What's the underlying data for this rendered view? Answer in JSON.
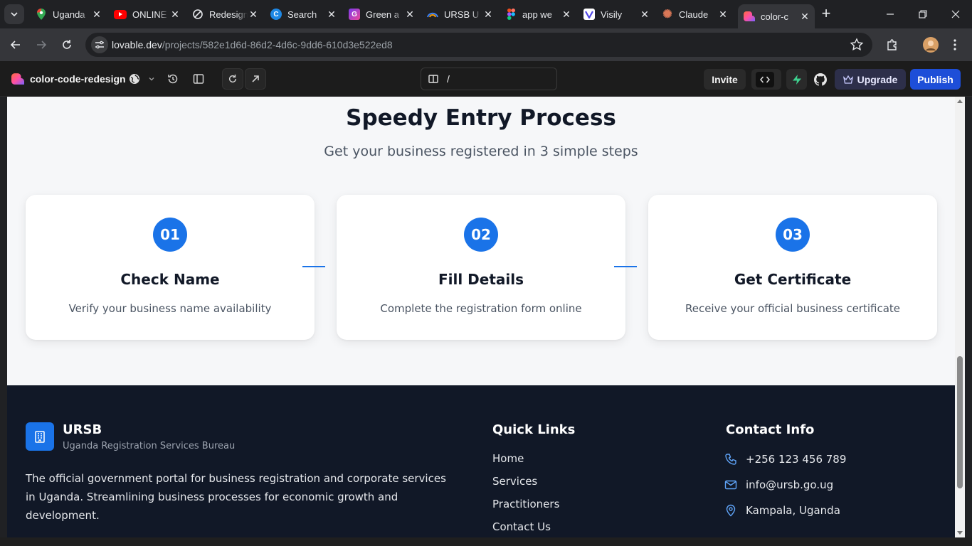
{
  "browser": {
    "tabs": [
      {
        "title": "Uganda",
        "icon": "google-maps-icon",
        "active": false
      },
      {
        "title": "ONLINE",
        "icon": "youtube-icon",
        "active": false
      },
      {
        "title": "Redesign",
        "icon": "redesign-icon",
        "active": false
      },
      {
        "title": "Search",
        "icon": "canva-icon",
        "active": false
      },
      {
        "title": "Green a",
        "icon": "gamma-icon",
        "active": false
      },
      {
        "title": "URSB U",
        "icon": "ursb-icon",
        "active": false
      },
      {
        "title": "app we",
        "icon": "figma-icon",
        "active": false
      },
      {
        "title": "Visily",
        "icon": "visily-icon",
        "active": false
      },
      {
        "title": "Claude",
        "icon": "claude-icon",
        "active": false
      },
      {
        "title": "color-c",
        "icon": "lovable-icon",
        "active": true
      }
    ],
    "url_host": "lovable.dev",
    "url_path": "/projects/582e1d6d-86d2-4d6c-9dd6-610d3e522ed8"
  },
  "appbar": {
    "project_name": "color-code-redesign",
    "path": "/",
    "invite_label": "Invite",
    "upgrade_label": "Upgrade",
    "publish_label": "Publish"
  },
  "steps": {
    "title": "Speedy Entry Process",
    "subtitle": "Get your business registered in 3 simple steps",
    "items": [
      {
        "number": "01",
        "title": "Check Name",
        "description": "Verify your business name availability"
      },
      {
        "number": "02",
        "title": "Fill Details",
        "description": "Complete the registration form online"
      },
      {
        "number": "03",
        "title": "Get Certificate",
        "description": "Receive your official business certificate"
      }
    ]
  },
  "footer": {
    "brand": "URSB",
    "brand_sub": "Uganda Registration Services Bureau",
    "description": "The official government portal for business registration and corporate services in Uganda. Streamlining business processes for economic growth and development.",
    "quick_links_heading": "Quick Links",
    "quick_links": [
      "Home",
      "Services",
      "Practitioners",
      "Contact Us"
    ],
    "contact_heading": "Contact Info",
    "phone": "+256 123 456 789",
    "email": "info@ursb.go.ug",
    "location": "Kampala, Uganda"
  },
  "colors": {
    "accent": "#1a73e8",
    "footer_bg": "#111827",
    "publish": "#1d4ed8"
  }
}
